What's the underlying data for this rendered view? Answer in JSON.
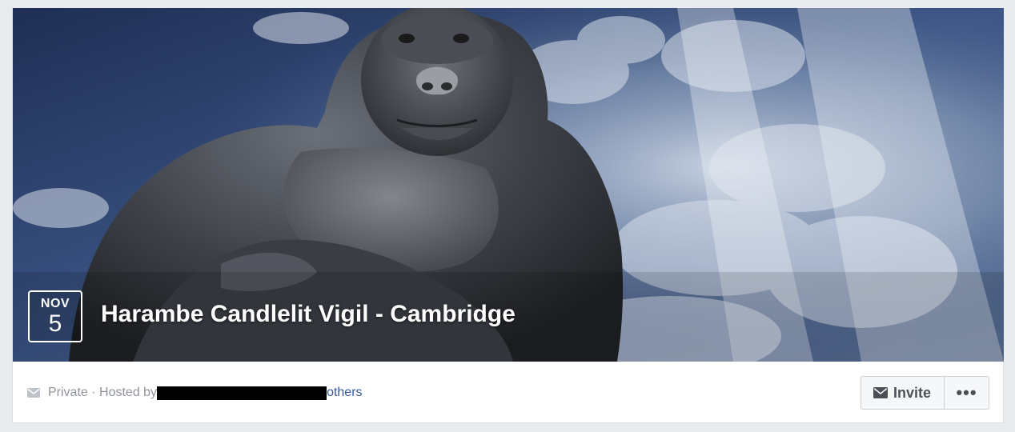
{
  "event": {
    "month": "NOV",
    "day": "5",
    "title": "Harambe Candlelit Vigil - Cambridge"
  },
  "info": {
    "privacy_prefix": "Private · Hosted by",
    "others_link": "others",
    "privacy_icon": "envelope-icon"
  },
  "actions": {
    "invite_label": "Invite",
    "invite_icon": "envelope-icon",
    "more_label": "•••"
  },
  "colors": {
    "link": "#365899",
    "muted_text": "#90949c",
    "button_text": "#4b4f56"
  }
}
